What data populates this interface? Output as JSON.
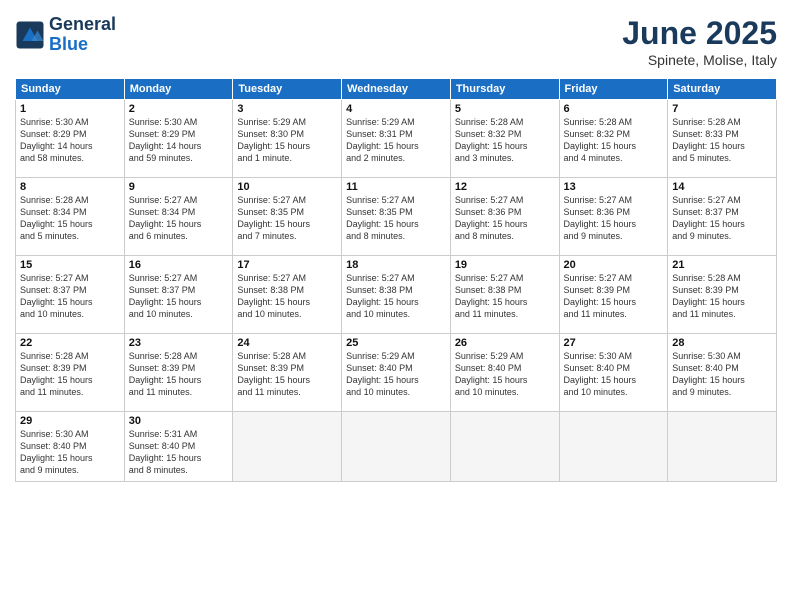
{
  "logo": {
    "line1": "General",
    "line2": "Blue"
  },
  "title": "June 2025",
  "subtitle": "Spinete, Molise, Italy",
  "days_of_week": [
    "Sunday",
    "Monday",
    "Tuesday",
    "Wednesday",
    "Thursday",
    "Friday",
    "Saturday"
  ],
  "weeks": [
    [
      {
        "day": 1,
        "info": "Sunrise: 5:30 AM\nSunset: 8:29 PM\nDaylight: 14 hours\nand 58 minutes."
      },
      {
        "day": 2,
        "info": "Sunrise: 5:30 AM\nSunset: 8:29 PM\nDaylight: 14 hours\nand 59 minutes."
      },
      {
        "day": 3,
        "info": "Sunrise: 5:29 AM\nSunset: 8:30 PM\nDaylight: 15 hours\nand 1 minute."
      },
      {
        "day": 4,
        "info": "Sunrise: 5:29 AM\nSunset: 8:31 PM\nDaylight: 15 hours\nand 2 minutes."
      },
      {
        "day": 5,
        "info": "Sunrise: 5:28 AM\nSunset: 8:32 PM\nDaylight: 15 hours\nand 3 minutes."
      },
      {
        "day": 6,
        "info": "Sunrise: 5:28 AM\nSunset: 8:32 PM\nDaylight: 15 hours\nand 4 minutes."
      },
      {
        "day": 7,
        "info": "Sunrise: 5:28 AM\nSunset: 8:33 PM\nDaylight: 15 hours\nand 5 minutes."
      }
    ],
    [
      {
        "day": 8,
        "info": "Sunrise: 5:28 AM\nSunset: 8:34 PM\nDaylight: 15 hours\nand 5 minutes."
      },
      {
        "day": 9,
        "info": "Sunrise: 5:27 AM\nSunset: 8:34 PM\nDaylight: 15 hours\nand 6 minutes."
      },
      {
        "day": 10,
        "info": "Sunrise: 5:27 AM\nSunset: 8:35 PM\nDaylight: 15 hours\nand 7 minutes."
      },
      {
        "day": 11,
        "info": "Sunrise: 5:27 AM\nSunset: 8:35 PM\nDaylight: 15 hours\nand 8 minutes."
      },
      {
        "day": 12,
        "info": "Sunrise: 5:27 AM\nSunset: 8:36 PM\nDaylight: 15 hours\nand 8 minutes."
      },
      {
        "day": 13,
        "info": "Sunrise: 5:27 AM\nSunset: 8:36 PM\nDaylight: 15 hours\nand 9 minutes."
      },
      {
        "day": 14,
        "info": "Sunrise: 5:27 AM\nSunset: 8:37 PM\nDaylight: 15 hours\nand 9 minutes."
      }
    ],
    [
      {
        "day": 15,
        "info": "Sunrise: 5:27 AM\nSunset: 8:37 PM\nDaylight: 15 hours\nand 10 minutes."
      },
      {
        "day": 16,
        "info": "Sunrise: 5:27 AM\nSunset: 8:37 PM\nDaylight: 15 hours\nand 10 minutes."
      },
      {
        "day": 17,
        "info": "Sunrise: 5:27 AM\nSunset: 8:38 PM\nDaylight: 15 hours\nand 10 minutes."
      },
      {
        "day": 18,
        "info": "Sunrise: 5:27 AM\nSunset: 8:38 PM\nDaylight: 15 hours\nand 10 minutes."
      },
      {
        "day": 19,
        "info": "Sunrise: 5:27 AM\nSunset: 8:38 PM\nDaylight: 15 hours\nand 11 minutes."
      },
      {
        "day": 20,
        "info": "Sunrise: 5:27 AM\nSunset: 8:39 PM\nDaylight: 15 hours\nand 11 minutes."
      },
      {
        "day": 21,
        "info": "Sunrise: 5:28 AM\nSunset: 8:39 PM\nDaylight: 15 hours\nand 11 minutes."
      }
    ],
    [
      {
        "day": 22,
        "info": "Sunrise: 5:28 AM\nSunset: 8:39 PM\nDaylight: 15 hours\nand 11 minutes."
      },
      {
        "day": 23,
        "info": "Sunrise: 5:28 AM\nSunset: 8:39 PM\nDaylight: 15 hours\nand 11 minutes."
      },
      {
        "day": 24,
        "info": "Sunrise: 5:28 AM\nSunset: 8:39 PM\nDaylight: 15 hours\nand 11 minutes."
      },
      {
        "day": 25,
        "info": "Sunrise: 5:29 AM\nSunset: 8:40 PM\nDaylight: 15 hours\nand 10 minutes."
      },
      {
        "day": 26,
        "info": "Sunrise: 5:29 AM\nSunset: 8:40 PM\nDaylight: 15 hours\nand 10 minutes."
      },
      {
        "day": 27,
        "info": "Sunrise: 5:30 AM\nSunset: 8:40 PM\nDaylight: 15 hours\nand 10 minutes."
      },
      {
        "day": 28,
        "info": "Sunrise: 5:30 AM\nSunset: 8:40 PM\nDaylight: 15 hours\nand 9 minutes."
      }
    ],
    [
      {
        "day": 29,
        "info": "Sunrise: 5:30 AM\nSunset: 8:40 PM\nDaylight: 15 hours\nand 9 minutes."
      },
      {
        "day": 30,
        "info": "Sunrise: 5:31 AM\nSunset: 8:40 PM\nDaylight: 15 hours\nand 8 minutes."
      },
      null,
      null,
      null,
      null,
      null
    ]
  ]
}
